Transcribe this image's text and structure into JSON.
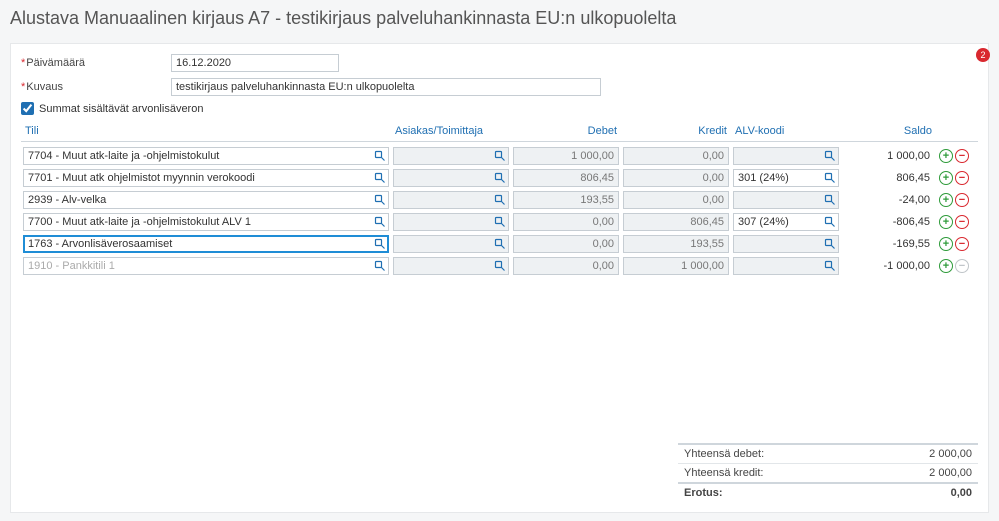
{
  "title": "Alustava Manuaalinen kirjaus A7  -  testikirjaus palveluhankinnasta EU:n ulkopuolelta",
  "badge": "2",
  "fields": {
    "date_label": "Päivämäärä",
    "date_value": "16.12.2020",
    "desc_label": "Kuvaus",
    "desc_value": "testikirjaus palveluhankinnasta EU:n ulkopuolelta",
    "vat_checkbox_label": "Summat sisältävät arvonlisäveron"
  },
  "headers": {
    "account": "Tili",
    "party": "Asiakas/Toimittaja",
    "debit": "Debet",
    "credit": "Kredit",
    "vat": "ALV-koodi",
    "balance": "Saldo"
  },
  "rows": [
    {
      "account": "7704 - Muut atk-laite ja -ohjelmistokulut",
      "party": "",
      "debit": "1 000,00",
      "credit": "0,00",
      "vat": "",
      "balance": "1 000,00",
      "can_delete": true,
      "active": false
    },
    {
      "account": "7701 - Muut atk ohjelmistot myynnin verokoodi",
      "party": "",
      "debit": "806,45",
      "credit": "0,00",
      "vat": "301 (24%)",
      "balance": "806,45",
      "can_delete": true,
      "active": false
    },
    {
      "account": "2939 - Alv-velka",
      "party": "",
      "debit": "193,55",
      "credit": "0,00",
      "vat": "",
      "balance": "-24,00",
      "can_delete": true,
      "active": false
    },
    {
      "account": "7700 - Muut atk-laite ja -ohjelmistokulut ALV 1",
      "party": "",
      "debit": "0,00",
      "credit": "806,45",
      "vat": "307 (24%)",
      "balance": "-806,45",
      "can_delete": true,
      "active": false
    },
    {
      "account": "1763 - Arvonlisäverosaamiset",
      "party": "",
      "debit": "0,00",
      "credit": "193,55",
      "vat": "",
      "balance": "-169,55",
      "can_delete": true,
      "active": true
    },
    {
      "account": "1910 - Pankkitili 1",
      "party": "",
      "debit": "0,00",
      "credit": "1 000,00",
      "vat": "",
      "balance": "-1 000,00",
      "can_delete": false,
      "active": false,
      "placeholder": true
    }
  ],
  "totals": {
    "debit_label": "Yhteensä debet:",
    "debit_value": "2 000,00",
    "credit_label": "Yhteensä kredit:",
    "credit_value": "2 000,00",
    "diff_label": "Erotus:",
    "diff_value": "0,00"
  }
}
